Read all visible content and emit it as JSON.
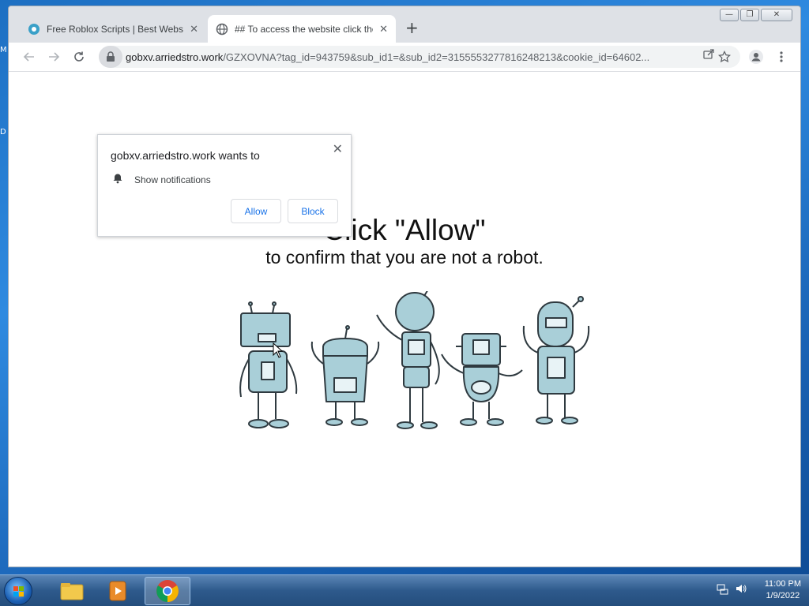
{
  "desktop": {
    "edge_labels": [
      "M",
      "D"
    ]
  },
  "browser": {
    "tabs": [
      {
        "title": "Free Roblox Scripts | Best Website",
        "close": "✕",
        "active": false
      },
      {
        "title": "## To access the website click the",
        "close": "✕",
        "active": true
      }
    ],
    "new_tab": "+",
    "window_controls": {
      "minimize": "—",
      "restore": "❐",
      "close": "✕"
    },
    "omnibox": {
      "host": "gobxv.arriedstro.work",
      "path": "/GZXOVNA?tag_id=943759&sub_id1=&sub_id2=3155553277816248213&cookie_id=64602..."
    }
  },
  "permission_popup": {
    "title": "gobxv.arriedstro.work wants to",
    "permission": "Show notifications",
    "allow_label": "Allow",
    "block_label": "Block",
    "close": "✕"
  },
  "page": {
    "headline": "Click \"Allow\"",
    "subline": "to confirm that you are not a robot."
  },
  "taskbar": {
    "clock_time": "11:00 PM",
    "clock_date": "1/9/2022"
  },
  "colors": {
    "link_blue": "#1a73e8",
    "robot_fill": "#a9cfd8",
    "desktop_blue": "#2f8ae0"
  }
}
